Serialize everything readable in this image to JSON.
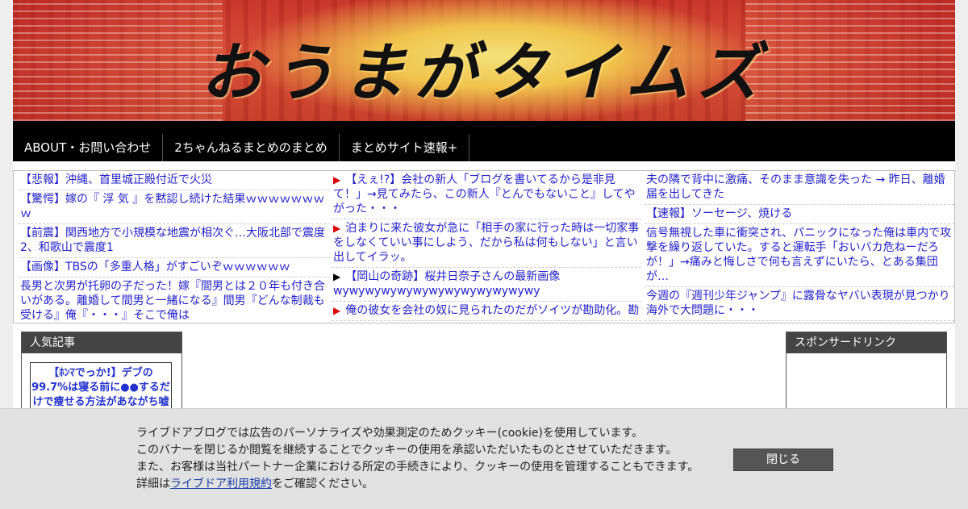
{
  "site": {
    "title": "おうまがタイムズ"
  },
  "nav": {
    "items": [
      "ABOUT・お問い合わせ",
      "2ちゃんねるまとめのまとめ",
      "まとめサイト速報+"
    ]
  },
  "feed": {
    "col1": [
      "【悲報】沖縄、首里城正殿付近で火災",
      "【驚愕】嫁の『 浮 気 』を黙認し続けた結果ｗｗｗｗｗｗｗｗ",
      "【前震】関西地方で小規模な地震が相次ぐ…大阪北部で震度2、和歌山で震度1",
      "【画像】TBSの「多重人格」がすごいぞｗｗｗｗｗｗ",
      "長男と次男が托卵の子だった！嫁『間男とは２０年も付き合いがある。離婚して間男と一緒になる』間男『どんな制裁も受ける』俺『・・・』そこで俺は"
    ],
    "col2": [
      "【えぇ!?】会社の新人「ブログを書いてるから是非見て！」→見てみたら、この新人『とんでもないこと』してやがった・・・",
      "泊まりに来た彼女が急に「相手の家に行った時は一切家事をしなくていい事にしよう、だから私は何もしない」と言い出してイラッ。",
      "【岡山の奇跡】桜井日奈子さんの最新画像wywywywywywywywywywywywywy",
      "俺の彼女を会社の奴に見られたのだがソイツが勘助化。勘"
    ],
    "col3": [
      "夫の隣で背中に激痛、そのまま意識を失った → 昨日、離婚届を出してきた",
      "【速報】ソーセージ、焼ける",
      "信号無視した車に衝突され、パニックになった俺は車内で攻撃を繰り返していた。すると運転手「おいバカ危ねーだろが！」→痛みと悔しさで何も言えずにいたら、とある集団が…",
      "今週の『週刊少年ジャンプ』に露骨なヤバい表現が見つかり海外で大問題に・・・"
    ]
  },
  "sidebar": {
    "popular_title": "人気記事",
    "popular_card": "【ﾎﾝﾏでっか!】デブの99.7%は寝る前に●●するだけで痩せる方法があながち嘘",
    "sponsor_title": "スポンサードリンク"
  },
  "cookie": {
    "line1": "ライブドアブログでは広告のパーソナライズや効果測定のためクッキー(cookie)を使用しています。",
    "line2": "このバナーを閉じるか閲覧を継続することでクッキーの使用を承認いただいたものとさせていただきます。",
    "line3": "また、お客様は当社パートナー企業における所定の手続きにより、クッキーの使用を管理することもできます。",
    "line4_prefix": "詳細は",
    "line4_link": "ライブドア利用規約",
    "line4_suffix": "をご確認ください。",
    "close_label": "閉じる"
  },
  "colors": {
    "link": "#2222cc",
    "marker": "#dd0000",
    "nav_bg": "#000000"
  }
}
